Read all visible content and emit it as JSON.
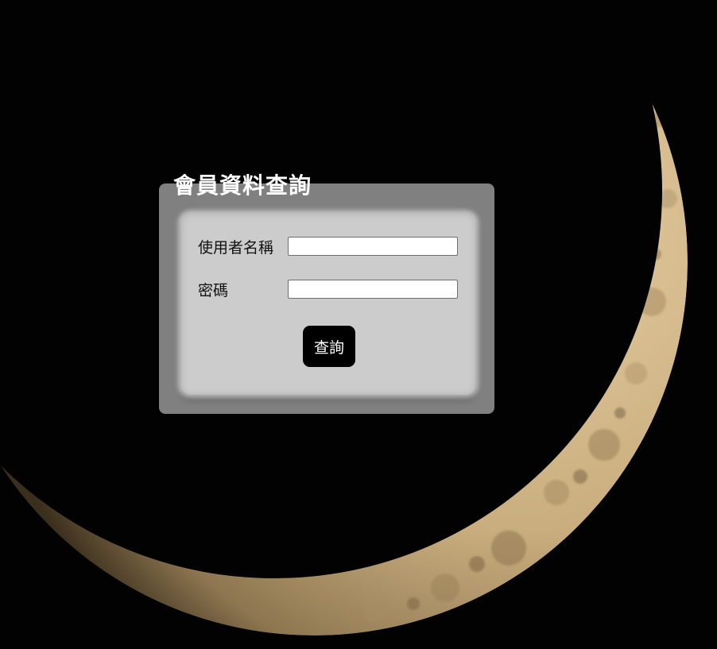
{
  "form": {
    "title": "會員資料查詢",
    "username_label": "使用者名稱",
    "username_value": "",
    "password_label": "密碼",
    "password_value": "",
    "submit_label": "查詢"
  },
  "colors": {
    "page_background": "#000000",
    "panel_background": "#808080",
    "inner_panel_background": "#cccccc",
    "button_background": "#000000",
    "button_text": "#ffffff",
    "title_text": "#ffffff"
  },
  "icons": {
    "background": "crescent-moon-photo"
  }
}
